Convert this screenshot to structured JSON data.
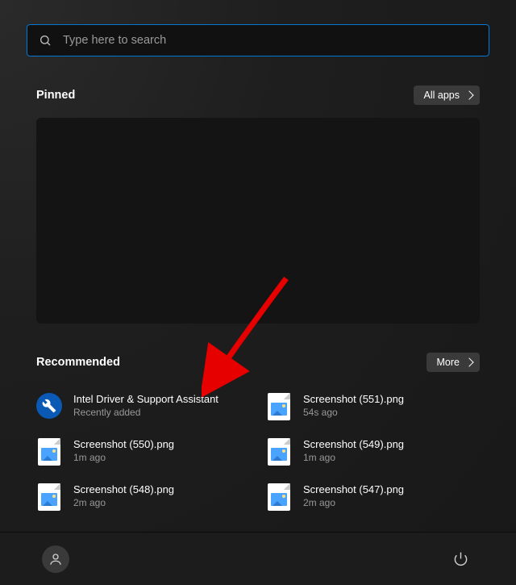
{
  "search": {
    "placeholder": "Type here to search"
  },
  "pinned": {
    "title": "Pinned",
    "all_apps_label": "All apps"
  },
  "recommended": {
    "title": "Recommended",
    "more_label": "More",
    "items": [
      {
        "icon": "intel",
        "title": "Intel Driver & Support Assistant",
        "sub": "Recently added"
      },
      {
        "icon": "image",
        "title": "Screenshot (551).png",
        "sub": "54s ago"
      },
      {
        "icon": "image",
        "title": "Screenshot (550).png",
        "sub": "1m ago"
      },
      {
        "icon": "image",
        "title": "Screenshot (549).png",
        "sub": "1m ago"
      },
      {
        "icon": "image",
        "title": "Screenshot (548).png",
        "sub": "2m ago"
      },
      {
        "icon": "image",
        "title": "Screenshot (547).png",
        "sub": "2m ago"
      }
    ]
  }
}
